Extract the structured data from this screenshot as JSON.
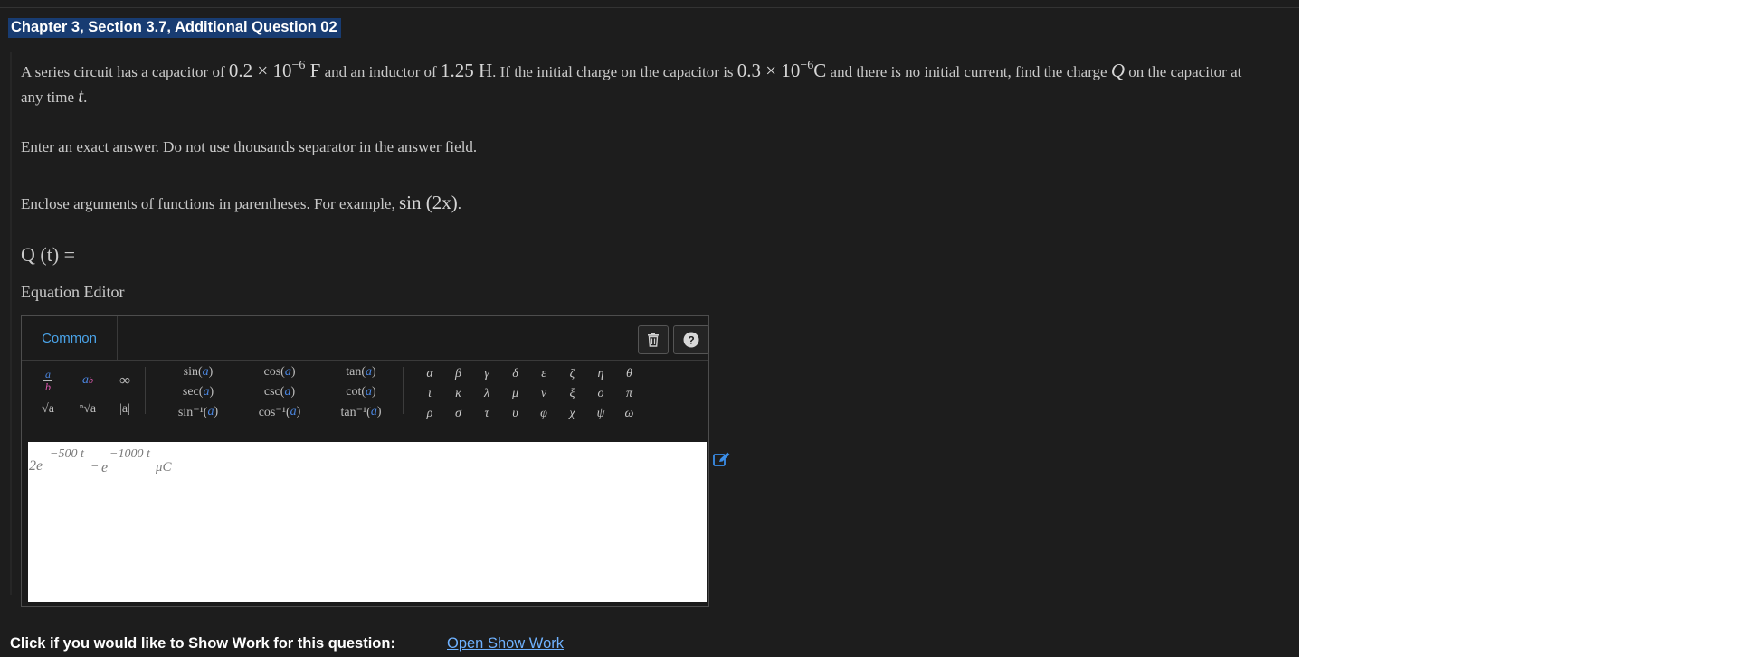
{
  "section_title": "Chapter 3, Section 3.7, Additional Question 02",
  "question": {
    "text_1": "A series circuit has a capacitor of ",
    "capacitance": "0.2 × 10",
    "capacitance_exp": "−6",
    "capacitance_unit": " F",
    "text_2": " and an inductor of ",
    "inductance": "1.25 H",
    "text_3": ". If the initial charge on the capacitor is ",
    "charge": "0.3 × 10",
    "charge_exp": "−6",
    "charge_unit": "C",
    "text_4": " and there is no initial current, find the charge ",
    "var_q": "Q",
    "text_5": " on the capacitor at any time ",
    "var_t": "t",
    "text_6": "."
  },
  "instruction_1": "Enter an exact answer. Do not use thousands separator in the answer field.",
  "instruction_2_text": "Enclose arguments of functions in parentheses. For example, ",
  "instruction_2_math": "sin (2x)",
  "instruction_2_end": ".",
  "answer_label": "Q (t) =",
  "editor_label": "Equation Editor",
  "editor": {
    "tab": "Common",
    "icons": [
      "trash-icon",
      "help-icon",
      "edit-icon"
    ],
    "templates": {
      "fraction": [
        "a",
        "b"
      ],
      "power": [
        "a",
        "b"
      ],
      "infinity": "∞",
      "sqrt": "√a",
      "nthroot": "ⁿ√a",
      "abs": "|a|"
    },
    "trig": [
      [
        "sin(a)",
        "cos(a)",
        "tan(a)"
      ],
      [
        "sec(a)",
        "csc(a)",
        "cot(a)"
      ],
      [
        "sin⁻¹(a)",
        "cos⁻¹(a)",
        "tan⁻¹(a)"
      ]
    ],
    "greek": [
      [
        "α",
        "β",
        "γ",
        "δ",
        "ε",
        "ζ",
        "η",
        "θ"
      ],
      [
        "ι",
        "κ",
        "λ",
        "μ",
        "ν",
        "ξ",
        "ο",
        "π"
      ],
      [
        "ρ",
        "σ",
        "τ",
        "υ",
        "φ",
        "χ",
        "ψ",
        "ω"
      ]
    ],
    "answer": {
      "coef": "2e",
      "exp1": "−500 t",
      "minus": "−",
      "e": "e",
      "exp2": "−1000 t",
      "unit": "μC"
    }
  },
  "show_work_prompt": "Click if you would like to Show Work for this question:",
  "show_work_link": "Open Show Work"
}
